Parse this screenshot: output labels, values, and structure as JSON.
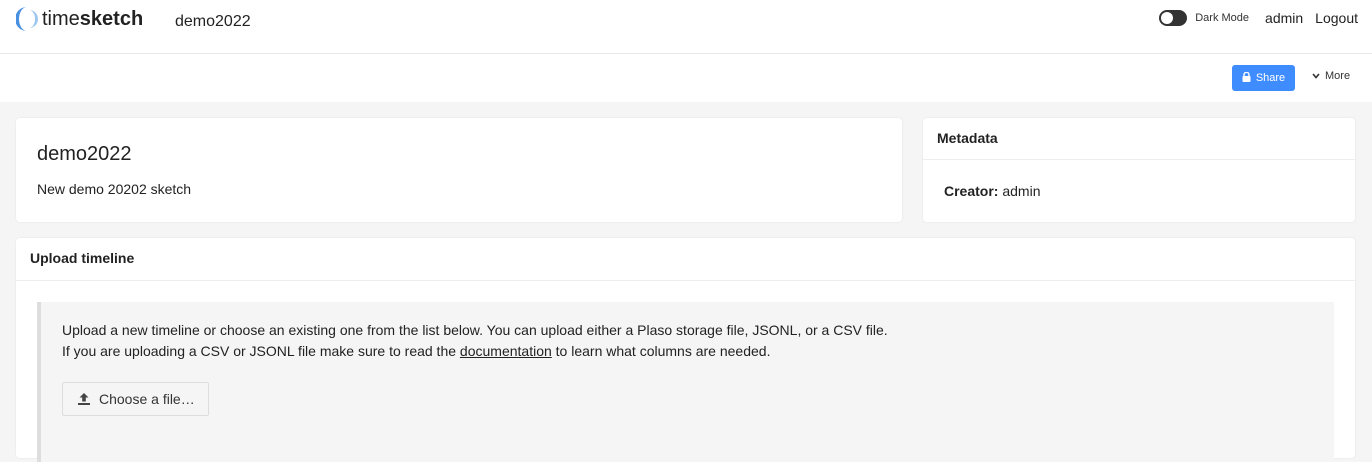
{
  "app": {
    "logo_prefix": "time",
    "logo_suffix": "sketch",
    "sketch_name": "demo2022"
  },
  "nav": {
    "dark_mode_label": "Dark Mode",
    "user": "admin",
    "logout": "Logout"
  },
  "actions": {
    "share_label": "Share",
    "more_label": "More"
  },
  "sketch": {
    "title": "demo2022",
    "description": "New demo 20202 sketch"
  },
  "metadata": {
    "heading": "Metadata",
    "creator_label": "Creator:",
    "creator_value": "admin"
  },
  "upload": {
    "heading": "Upload timeline",
    "line1": "Upload a new timeline or choose an existing one from the list below. You can upload either a Plaso storage file, JSONL, or a CSV file.",
    "line2_before": "If you are uploading a CSV or JSONL file make sure to read the",
    "line2_link": "documentation",
    "line2_after": "to learn what columns are needed.",
    "choose_label": "Choose a file…"
  },
  "colors": {
    "accent": "#3f8cff",
    "logo_blue": "#4a90e2",
    "logo_light": "#9cc7ef"
  },
  "icons": {
    "logo": "timesketch-logo-icon",
    "toggle": "toggle-switch-icon",
    "share": "lock-icon",
    "more": "chevron-down-icon",
    "upload": "upload-icon"
  }
}
